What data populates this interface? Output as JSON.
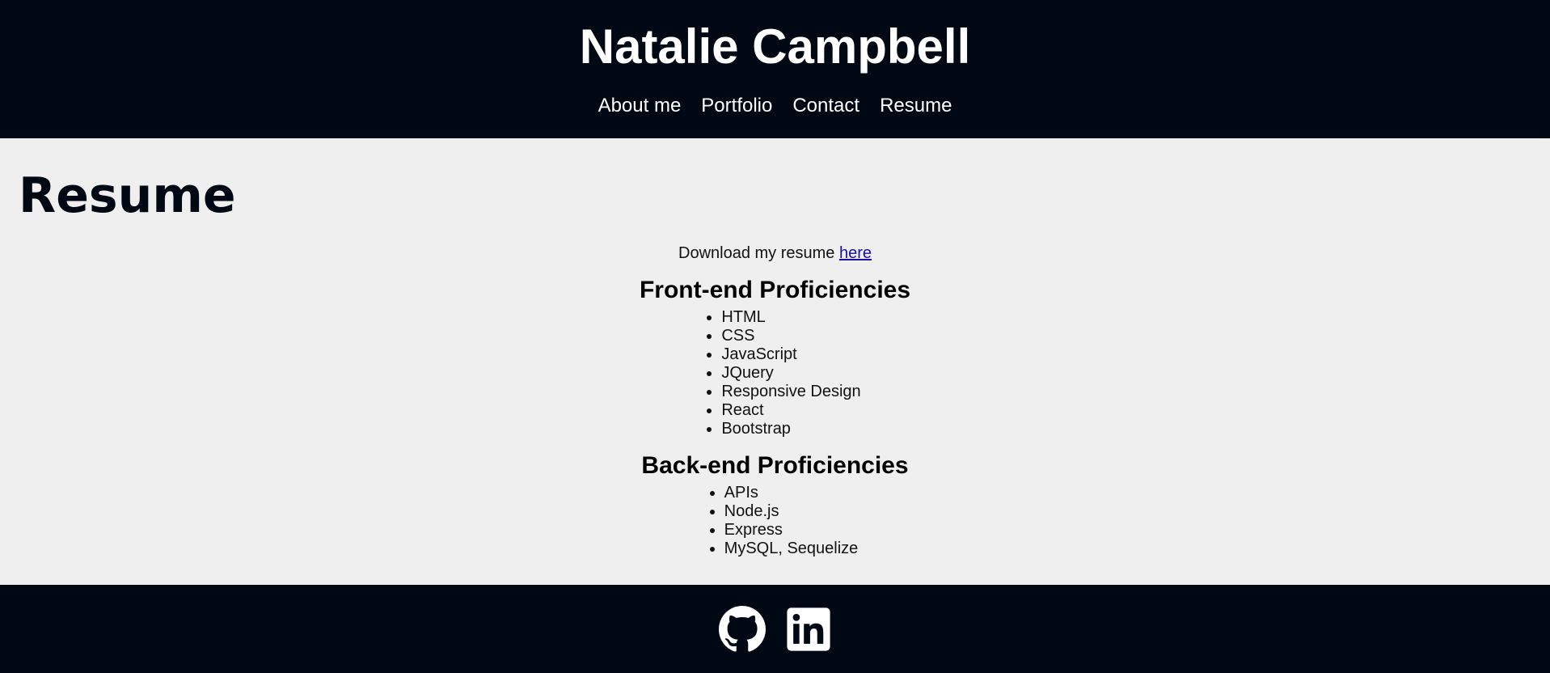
{
  "header": {
    "site_title": "Natalie Campbell",
    "nav": [
      {
        "label": "About me"
      },
      {
        "label": "Portfolio"
      },
      {
        "label": "Contact"
      },
      {
        "label": "Resume"
      }
    ]
  },
  "main": {
    "section_title": "Resume",
    "download": {
      "text": "Download my resume ",
      "link_label": "here"
    },
    "frontend": {
      "title": "Front-end Proficiencies",
      "items": [
        "HTML",
        "CSS",
        "JavaScript",
        "JQuery",
        "Responsive Design",
        "React",
        "Bootstrap"
      ]
    },
    "backend": {
      "title": "Back-end Proficiencies",
      "items": [
        "APIs",
        "Node.js",
        "Express",
        "MySQL, Sequelize"
      ]
    }
  },
  "footer": {
    "icons": [
      "github-icon",
      "linkedin-icon"
    ]
  },
  "colors": {
    "header_bg": "#000814",
    "page_bg": "#efefef",
    "link": "#1a0dab"
  }
}
